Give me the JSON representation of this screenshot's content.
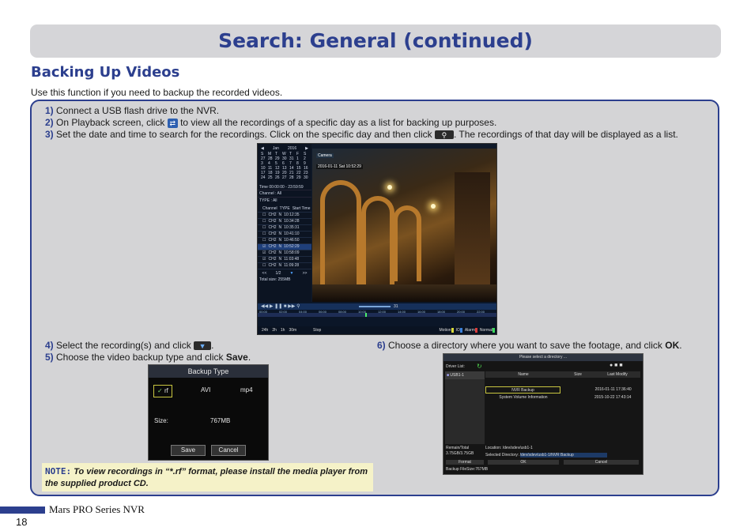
{
  "header": {
    "title": "Search: General (continued)"
  },
  "section": {
    "title": "Backing Up Videos",
    "intro": "Use this function if you need to backup the recorded videos."
  },
  "steps": [
    {
      "num": "1)",
      "text": "Connect a USB flash drive to the NVR."
    },
    {
      "num": "2)",
      "text_before": "On Playback screen, click",
      "text_after": "to view all the recordings of a specific day as a list for backing up purposes."
    },
    {
      "num": "3)",
      "text_before": "Set the date and time to search for the recordings. Click on the specific day and then click",
      "text_after": ". The recordings of that day will be displayed as a list."
    },
    {
      "num": "4)",
      "text_before": "Select the recording(s) and click",
      "text_after": "."
    },
    {
      "num": "5)",
      "text_before": "Choose the video backup type and click",
      "bold": "Save",
      "text_after": "."
    },
    {
      "num": "6)",
      "text_before": "Choose a directory where you want to save the footage, and click",
      "bold": "OK",
      "text_after": "."
    }
  ],
  "playback": {
    "calendar": {
      "month": "Jan",
      "year": "2016",
      "days": [
        "S",
        "M",
        "T",
        "W",
        "T",
        "F",
        "S"
      ],
      "weeks": [
        [
          "27",
          "28",
          "29",
          "30",
          "31",
          "1",
          "2"
        ],
        [
          "3",
          "4",
          "5",
          "6",
          "7",
          "8",
          "9"
        ],
        [
          "10",
          "11",
          "12",
          "13",
          "14",
          "15",
          "16"
        ],
        [
          "17",
          "18",
          "19",
          "20",
          "21",
          "22",
          "23"
        ],
        [
          "24",
          "25",
          "26",
          "27",
          "28",
          "29",
          "30"
        ]
      ]
    },
    "time_label": "Time 00:00:00 - 23:59:59",
    "channel_label": "Channel : All",
    "type_label": "TYPE : All",
    "list_headers": [
      "Channel",
      "TYPE",
      "Start Time"
    ],
    "rows": [
      [
        "CH2",
        "N",
        "10:12:35"
      ],
      [
        "CH2",
        "N",
        "10:34:28"
      ],
      [
        "CH2",
        "N",
        "10:35:31"
      ],
      [
        "CH2",
        "N",
        "10:41:10"
      ],
      [
        "CH2",
        "N",
        "10:46:50"
      ],
      [
        "CH2",
        "N",
        "10:52:29"
      ],
      [
        "CH2",
        "N",
        "10:58:09"
      ],
      [
        "CH2",
        "N",
        "11:03:48"
      ],
      [
        "CH2",
        "N",
        "11:09:28"
      ]
    ],
    "pager": "1/2",
    "total_size": "Total size:  255MB",
    "video_labels": {
      "camera": "Camera",
      "timestamp": "2016-01-11 Sat 10:52:29"
    },
    "timeline_hours": [
      "00:00",
      "02:00",
      "04:00",
      "06:00",
      "08:00",
      "10:00",
      "12:00",
      "14:00",
      "16:00",
      "18:00",
      "20:00",
      "22:00"
    ],
    "zoom_value": "31",
    "footer_ranges": [
      "24h",
      "2h",
      "1h",
      "30m"
    ],
    "footer_stop": "Stop",
    "legend": [
      "Motion",
      "IO",
      "Alarm",
      "Normal"
    ],
    "legend_colors": [
      "#d9d93a",
      "#3a7fd9",
      "#d93a3a",
      "#3ad95a"
    ]
  },
  "backup_type": {
    "title": "Backup Type",
    "options": [
      "rf",
      "AVI",
      "mp4"
    ],
    "size_label": "Size:",
    "size_value": "767MB",
    "save": "Save",
    "cancel": "Cancel"
  },
  "directory": {
    "title": "Please select a directory ...",
    "driver_list": "Driver List:",
    "usb": "USB1-1",
    "columns": [
      "Name",
      "Size",
      "Last Modify"
    ],
    "entries": [
      {
        "name": "NVR Backup",
        "size": "",
        "modified": "2016-01-11 17:36:40"
      },
      {
        "name": "System Volume Information",
        "size": "",
        "modified": "2015-10-22 17:43:14"
      }
    ],
    "remain_label": "Remain/Total",
    "remain_value": "3.75GB/3.75GB",
    "location_label": "Location:",
    "location_value": "/dev/sdev/usb1-1",
    "selected_label": "Selected Directory:",
    "selected_value": "/dev/sdev/usb1-1/NVR Backup",
    "format": "Format",
    "ok": "OK",
    "cancel": "Cancel",
    "file_size": "Backup FileSize:767MB"
  },
  "note": {
    "label": "NOTE:",
    "text": "To view recordings in “*.rf” format, please install the media player from the supplied product CD."
  },
  "footer": {
    "product": "Mars PRO Series NVR",
    "page": "18"
  },
  "colors": {
    "accent": "#2c3f8e",
    "panel": "#d4d4d6",
    "note_bg": "#f5f2c8"
  }
}
